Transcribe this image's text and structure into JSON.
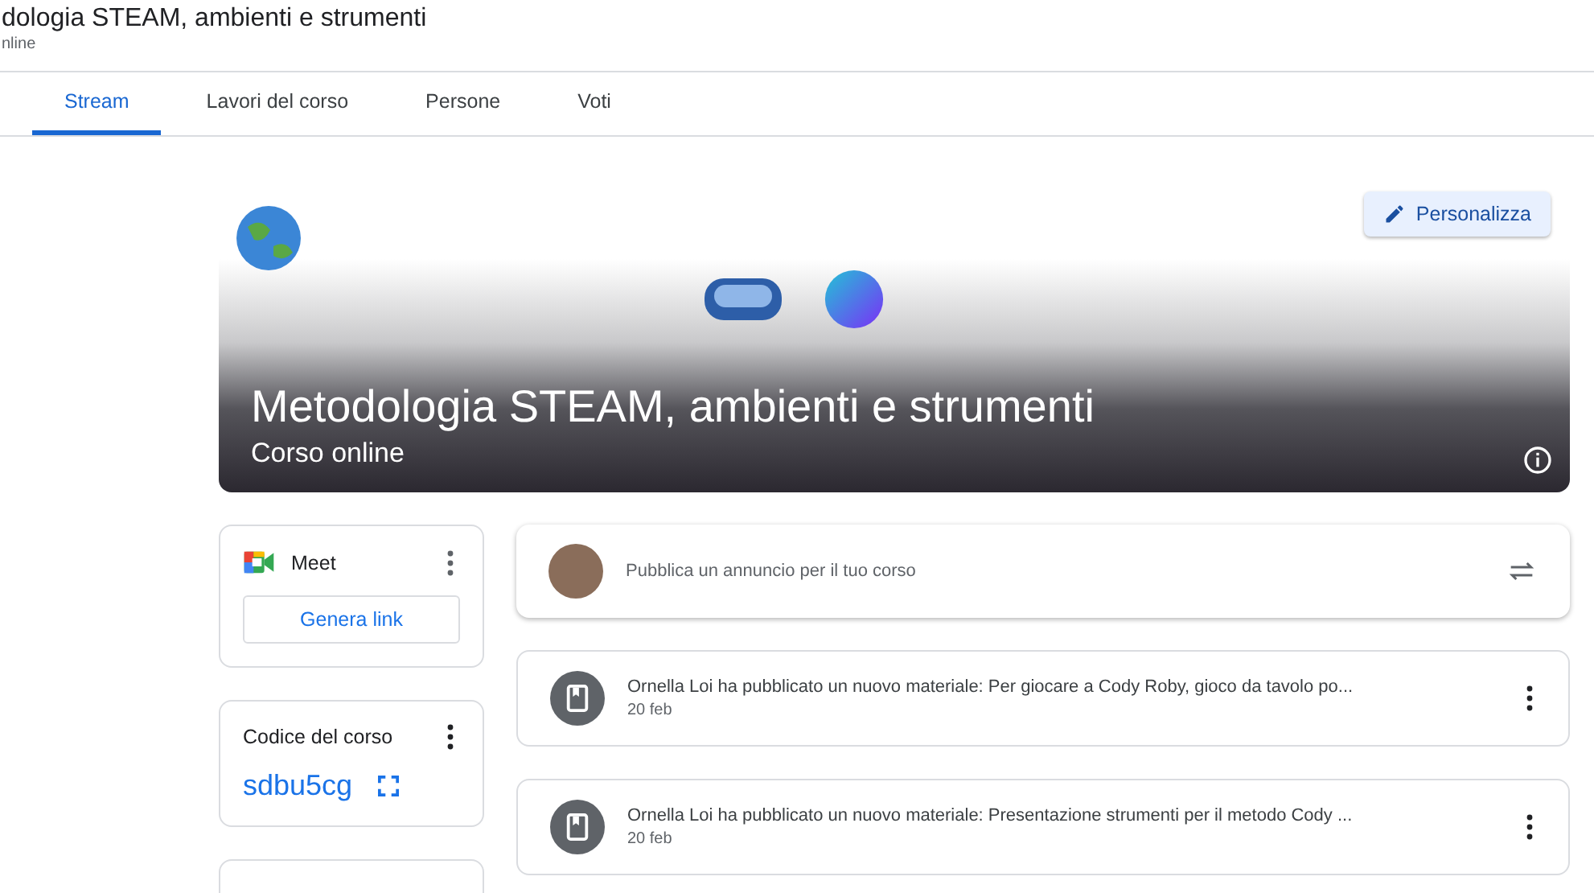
{
  "header": {
    "title": "dologia STEAM, ambienti e strumenti",
    "subtitle": "nline"
  },
  "tabs": [
    {
      "label": "Stream",
      "selected": true
    },
    {
      "label": "Lavori del corso",
      "selected": false
    },
    {
      "label": "Persone",
      "selected": false
    },
    {
      "label": "Voti",
      "selected": false
    }
  ],
  "banner": {
    "title": "Metodologia STEAM, ambienti e strumenti",
    "subtitle": "Corso online",
    "customize_button": "Personalizza"
  },
  "meet": {
    "title": "Meet",
    "button": "Genera link"
  },
  "course_code": {
    "label": "Codice del corso",
    "code": "sdbu5cg"
  },
  "announce": {
    "placeholder": "Pubblica un annuncio per il tuo corso"
  },
  "posts": [
    {
      "text": "Ornella Loi ha pubblicato un nuovo materiale: Per giocare a Cody Roby, gioco da tavolo po...",
      "date": "20 feb"
    },
    {
      "text": "Ornella Loi ha pubblicato un nuovo materiale: Presentazione strumenti per il metodo Cody ...",
      "date": "20 feb"
    }
  ]
}
